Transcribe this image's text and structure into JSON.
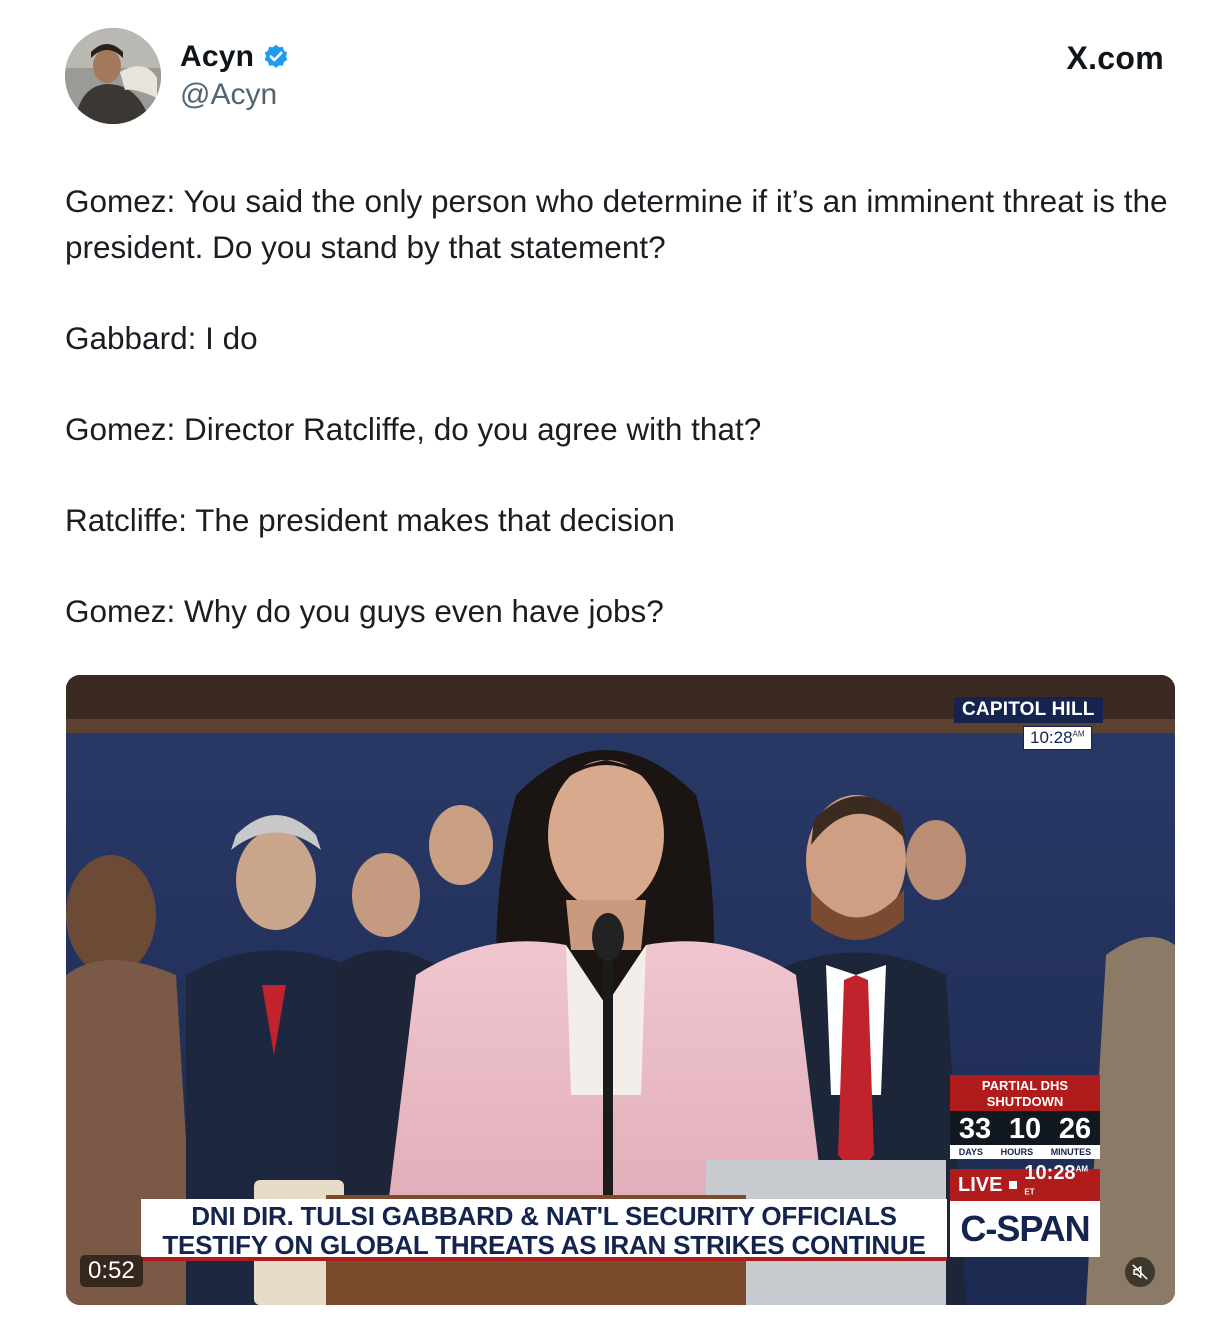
{
  "author": {
    "display_name": "Acyn",
    "handle": "@Acyn",
    "verified_icon": "verified-badge-icon",
    "verified_color": "#1d9bf0"
  },
  "site": {
    "label": "X.com"
  },
  "tweet": {
    "paragraphs": [
      "Gomez: You said the only person who determine if it’s an imminent threat is the president. Do you stand by that statement?",
      "Gabbard: I do",
      "Gomez: Director Ratcliffe, do you agree with that?",
      "Ratcliffe: The president makes that decision",
      "Gomez: Why do you guys even have jobs?"
    ]
  },
  "video": {
    "location": "CAPITOL HILL",
    "clock_time": "10:28",
    "clock_suffix": "AM",
    "shutdown": {
      "title_line1": "PARTIAL DHS",
      "title_line2": "SHUTDOWN",
      "days": "33",
      "hours": "10",
      "minutes": "26",
      "days_label": "DAYS",
      "hours_label": "HOURS",
      "minutes_label": "MINUTES"
    },
    "live": {
      "label": "LIVE",
      "time": "10:28",
      "suffix": "AM ET"
    },
    "network": "C-SPAN",
    "headline_line1": "DNI DIR. TULSI GABBARD & NAT'L SECURITY OFFICIALS",
    "headline_line2": "TESTIFY ON GLOBAL THREATS AS IRAN STRIKES CONTINUE",
    "duration": "0:52",
    "mute_icon": "muted-speaker-icon",
    "colors": {
      "navy": "#14244f",
      "red": "#b01c1c"
    }
  }
}
